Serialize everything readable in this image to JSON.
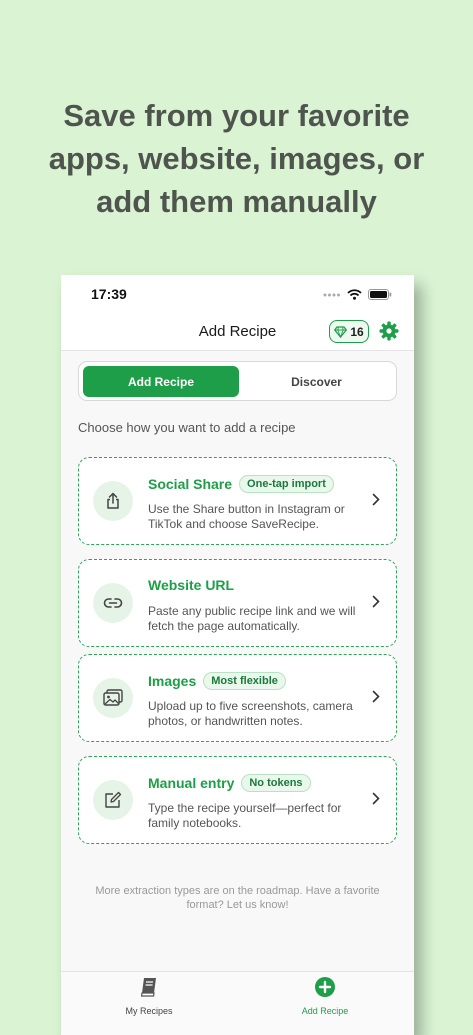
{
  "headline": "Save from your favorite apps, website, images, or add them manually",
  "status": {
    "time": "17:39"
  },
  "nav": {
    "title": "Add Recipe",
    "tokens": "16"
  },
  "segment": {
    "active": "Add Recipe",
    "inactive": "Discover"
  },
  "intro": "Choose how you want to add a recipe",
  "cards": [
    {
      "title": "Social Share",
      "badge": "One-tap import",
      "desc": "Use the Share button in Instagram or TikTok and choose SaveRecipe.",
      "icon": "share-icon"
    },
    {
      "title": "Website URL",
      "badge": "",
      "desc": "Paste any public recipe link and we will fetch the page automatically.",
      "icon": "link-icon"
    },
    {
      "title": "Images",
      "badge": "Most flexible",
      "desc": "Upload up to five screenshots, camera photos, or handwritten notes.",
      "icon": "image-icon"
    },
    {
      "title": "Manual entry",
      "badge": "No tokens",
      "desc": "Type the recipe yourself—perfect for family notebooks.",
      "icon": "edit-icon"
    }
  ],
  "footnote": "More extraction types are on the roadmap. Have a favorite format? Let us know!",
  "tabs": {
    "my_recipes": "My Recipes",
    "add_recipe": "Add Recipe"
  },
  "colors": {
    "brand": "#1e9e48",
    "background": "#d9f3d3"
  }
}
